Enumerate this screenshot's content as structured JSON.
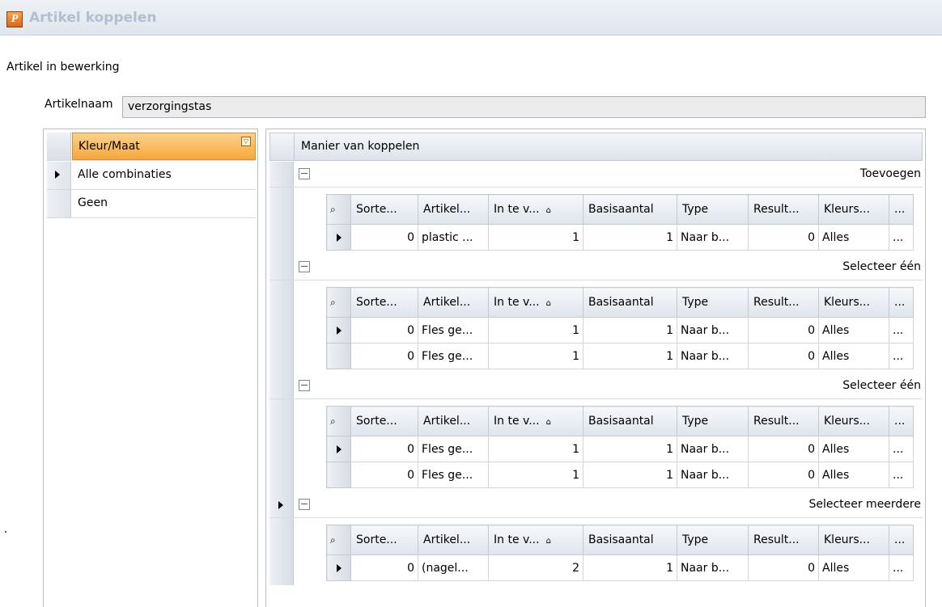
{
  "window": {
    "title": "Artikel koppelen"
  },
  "section_label": "Artikel in bewerking",
  "article": {
    "label": "Artikelnaam",
    "value": "verzorgingstas"
  },
  "left_grid": {
    "header": "Kleur/Maat",
    "rows": [
      {
        "label": "Alle combinaties",
        "current": true
      },
      {
        "label": "Geen",
        "current": false
      }
    ]
  },
  "right_grid": {
    "header": "Manier van koppelen",
    "columns": [
      "Sorte...",
      "Artikel...",
      "In te v...",
      "Basisaantal",
      "Type",
      "Result...",
      "Kleurs...",
      "..."
    ],
    "groups": [
      {
        "title": "Toevoegen",
        "current": false,
        "rows": [
          {
            "current": true,
            "cells": [
              "0",
              "plastic ...",
              "1",
              "1",
              "Naar b...",
              "0",
              "Alles",
              "..."
            ]
          }
        ]
      },
      {
        "title": "Selecteer één",
        "current": false,
        "rows": [
          {
            "current": true,
            "cells": [
              "0",
              "Fles ge...",
              "1",
              "1",
              "Naar b...",
              "0",
              "Alles",
              "..."
            ]
          },
          {
            "current": false,
            "cells": [
              "0",
              "Fles ge...",
              "1",
              "1",
              "Naar b...",
              "0",
              "Alles",
              "..."
            ]
          }
        ]
      },
      {
        "title": "Selecteer één",
        "current": false,
        "rows": [
          {
            "current": true,
            "cells": [
              "0",
              "Fles ge...",
              "1",
              "1",
              "Naar b...",
              "0",
              "Alles",
              "..."
            ]
          },
          {
            "current": false,
            "cells": [
              "0",
              "Fles ge...",
              "1",
              "1",
              "Naar b...",
              "0",
              "Alles",
              "..."
            ]
          }
        ]
      },
      {
        "title": "Selecteer meerdere",
        "current": true,
        "rows": [
          {
            "current": true,
            "cells": [
              "0",
              "(nagel...",
              "2",
              "1",
              "Naar b...",
              "0",
              "Alles",
              "..."
            ]
          }
        ]
      }
    ]
  },
  "colors": {
    "header_selected": "#f6a73a",
    "title_text": "#b3bfce"
  }
}
